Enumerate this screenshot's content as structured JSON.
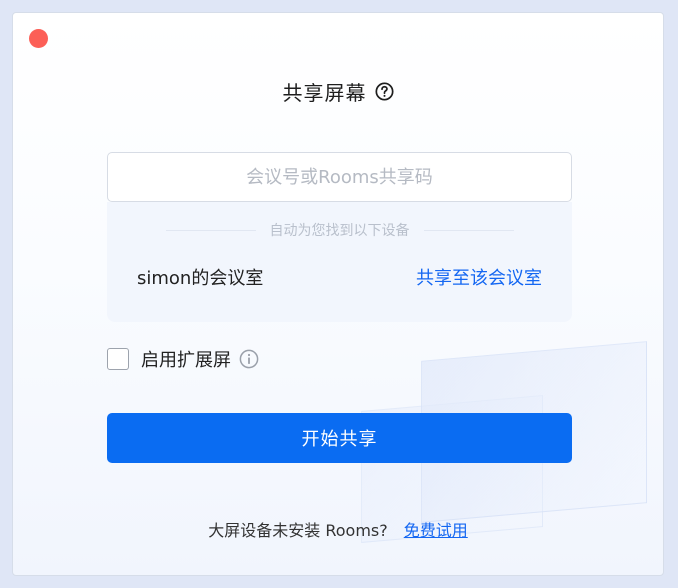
{
  "window": {
    "title": "共享屏幕"
  },
  "colors": {
    "accent": "#0a6cf2",
    "link": "#1467f2",
    "close": "#fc5f57"
  },
  "code_input": {
    "placeholder": "会议号或Rooms共享码",
    "value": ""
  },
  "devices": {
    "divider_text": "自动为您找到以下设备",
    "items": [
      {
        "name": "simon的会议室",
        "action_label": "共享至该会议室"
      }
    ]
  },
  "extend_screen": {
    "label": "启用扩展屏",
    "checked": false
  },
  "start_button": {
    "label": "开始共享"
  },
  "footer": {
    "text": "大屏设备未安装 Rooms?",
    "link_label": "免费试用"
  },
  "icons": {
    "help": "help-circle-icon",
    "info": "info-circle-icon"
  }
}
